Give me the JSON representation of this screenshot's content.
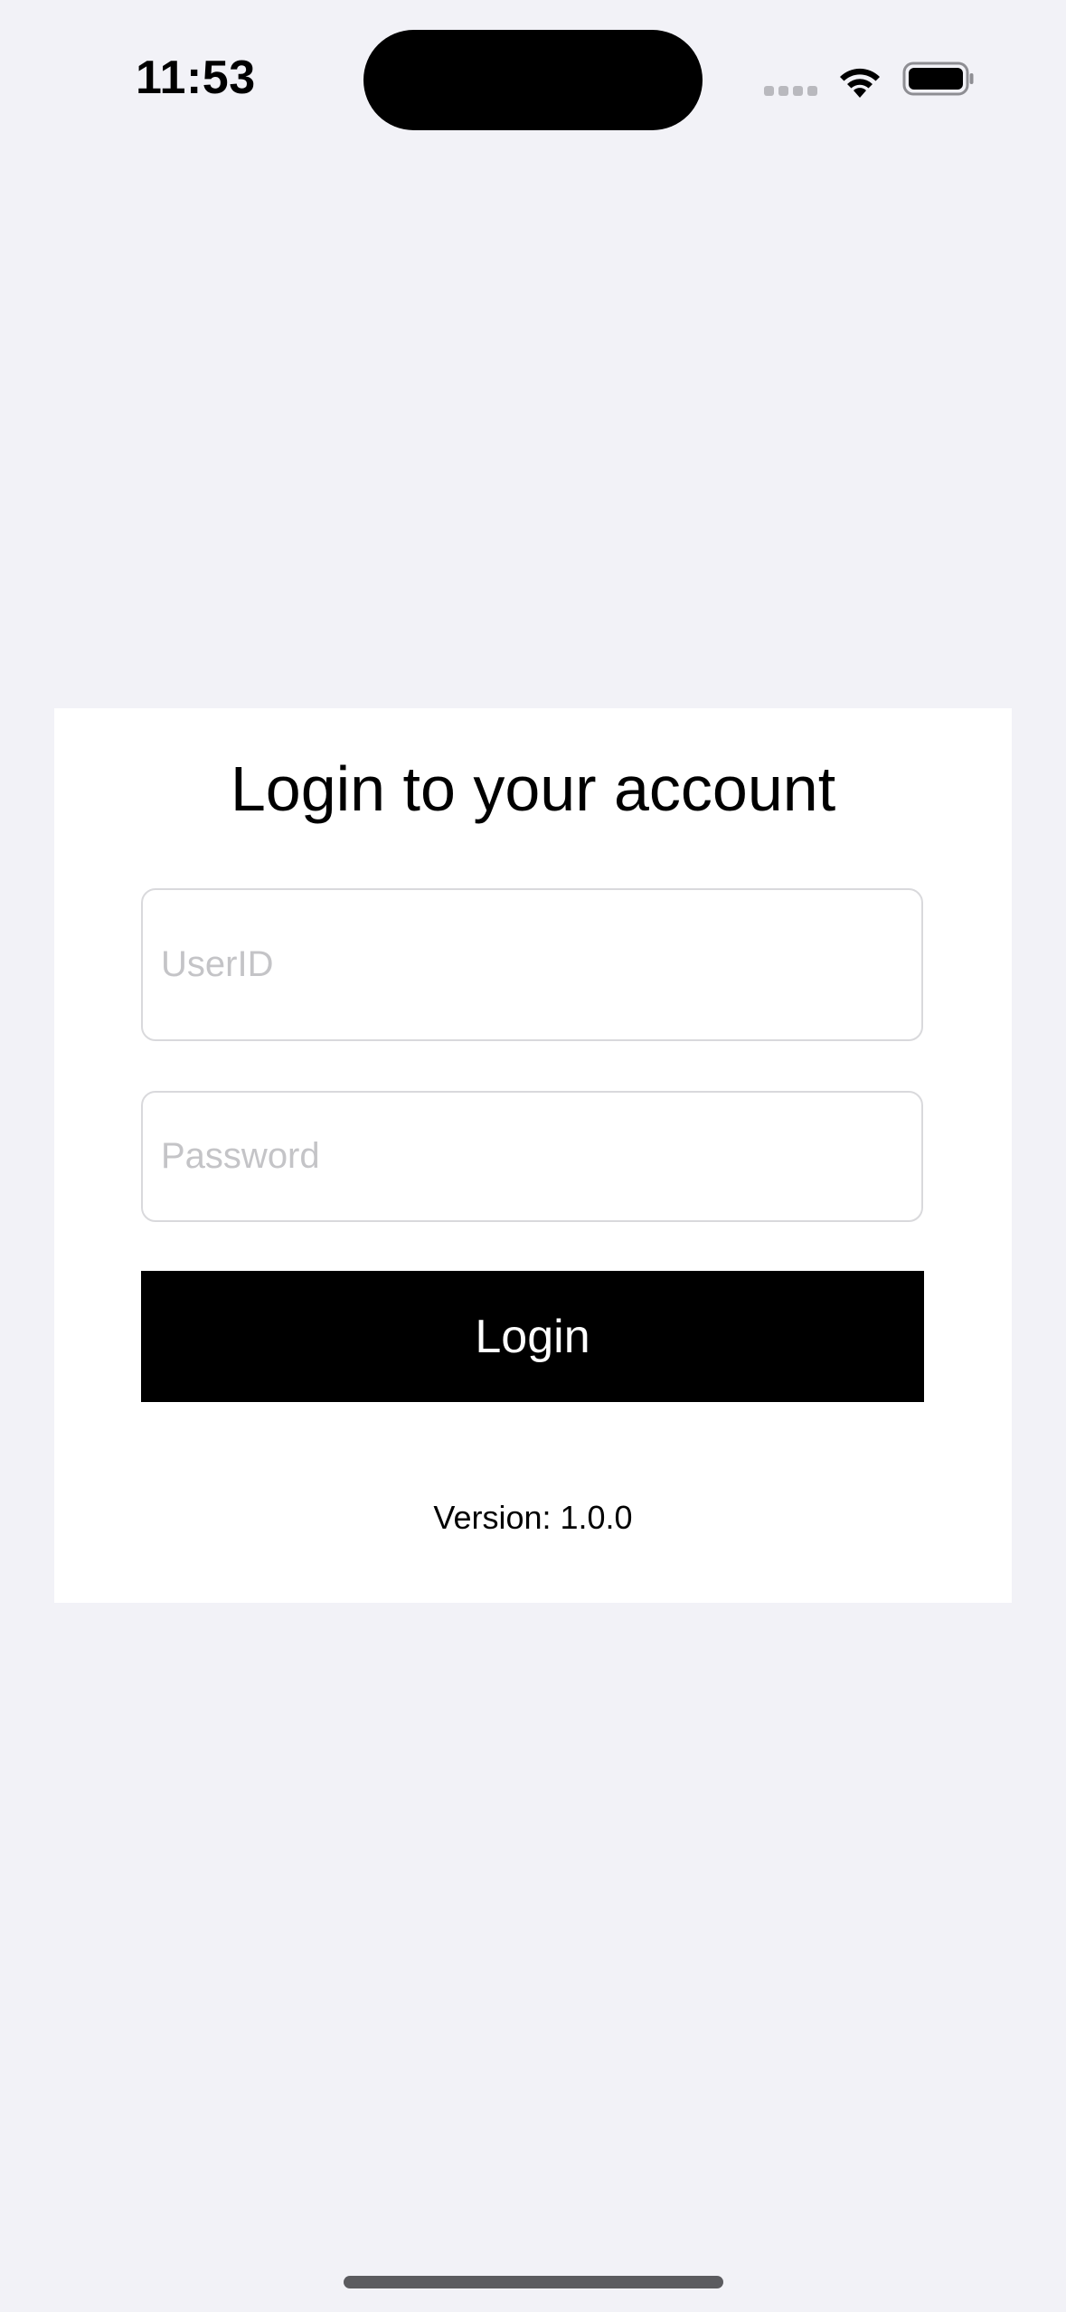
{
  "status_bar": {
    "time": "11:53",
    "icons": [
      "cellular-signal-icon",
      "wifi-icon",
      "battery-icon"
    ]
  },
  "login_card": {
    "title": "Login to your account",
    "userid_placeholder": "UserID",
    "userid_value": "",
    "password_placeholder": "Password",
    "password_value": "",
    "login_button_label": "Login",
    "version_text": "Version: 1.0.0"
  },
  "colors": {
    "background": "#f2f2f7",
    "card": "#ffffff",
    "button": "#000000",
    "button_text": "#ffffff",
    "placeholder": "#c4c4c7"
  }
}
